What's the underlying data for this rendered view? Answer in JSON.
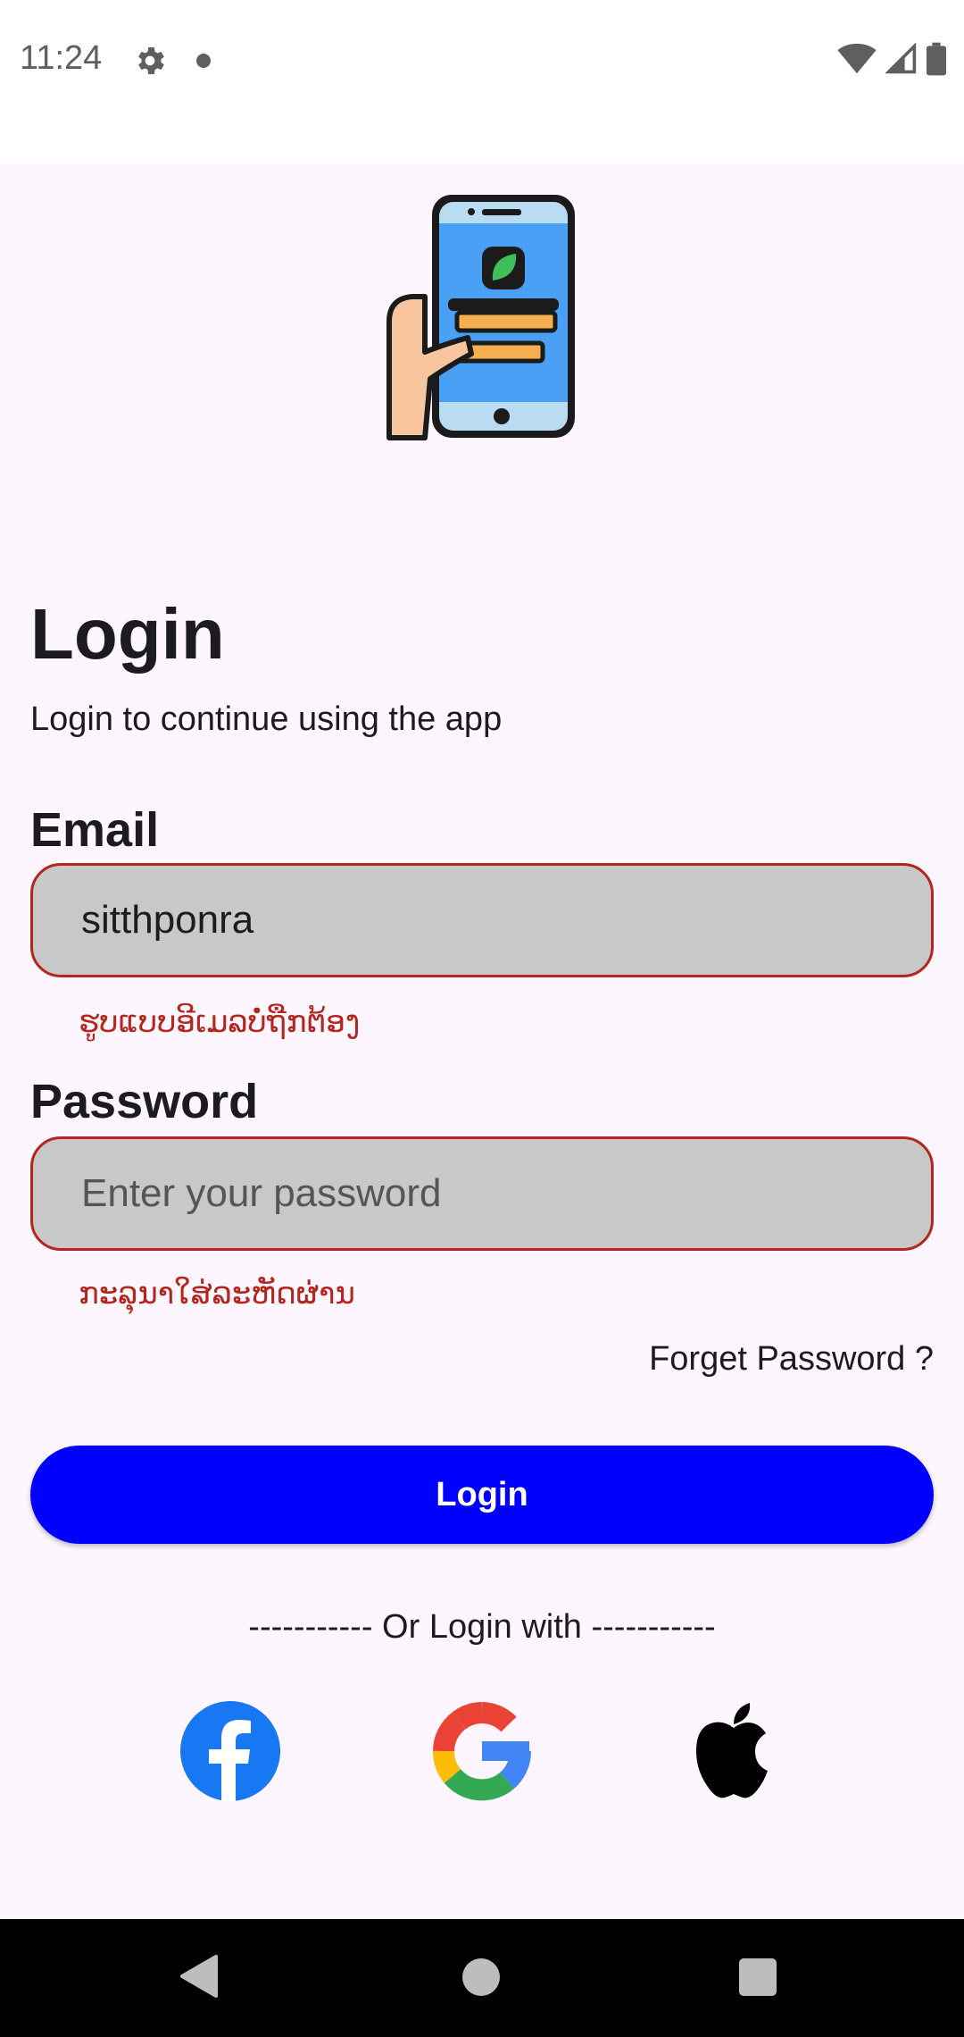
{
  "status_bar": {
    "time": "11:24",
    "icons": [
      "gear-icon",
      "dot-icon",
      "wifi-icon",
      "signal-icon",
      "battery-icon"
    ]
  },
  "illustration": {
    "icon": "phone-hand-icon"
  },
  "header": {
    "title": "Login",
    "subtitle": "Login to continue using the app"
  },
  "email": {
    "label": "Email",
    "value": "sitthponra",
    "error": "ຮູບແບບອີເມລບໍ່ຖືກຕ້ອງ"
  },
  "password": {
    "label": "Password",
    "placeholder": "Enter your password",
    "error": "ກະລຸນາໃສ່ລະຫັດຜ່ານ"
  },
  "forget_password": "Forget Password ?",
  "login_button": "Login",
  "divider": "----------- Or Login with -----------",
  "social": [
    "facebook-icon",
    "google-icon",
    "apple-icon"
  ],
  "colors": {
    "primary": "#0000ff",
    "error": "#b3261e",
    "field_bg": "#c8c8c8",
    "page_bg": "#fdf6fe"
  }
}
